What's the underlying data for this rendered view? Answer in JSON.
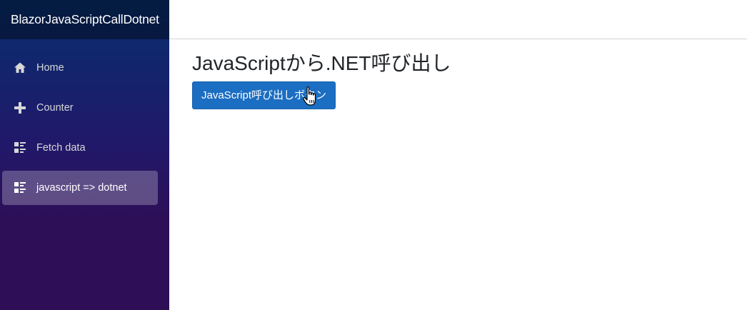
{
  "app": {
    "brand": "BlazorJavaScriptCallDotnet"
  },
  "sidebar": {
    "items": [
      {
        "label": "Home",
        "icon": "home-icon",
        "active": false
      },
      {
        "label": "Counter",
        "icon": "plus-icon",
        "active": false
      },
      {
        "label": "Fetch data",
        "icon": "list-rich-icon",
        "active": false
      },
      {
        "label": "javascript => dotnet",
        "icon": "list-rich-icon",
        "active": true
      }
    ]
  },
  "main": {
    "title": "JavaScriptから.NET呼び出し",
    "button_label": "JavaScript呼び出しボタン"
  },
  "colors": {
    "accent": "#1b6ec2",
    "sidebar_top": "#062f6e",
    "sidebar_bottom": "#2e0e55"
  }
}
